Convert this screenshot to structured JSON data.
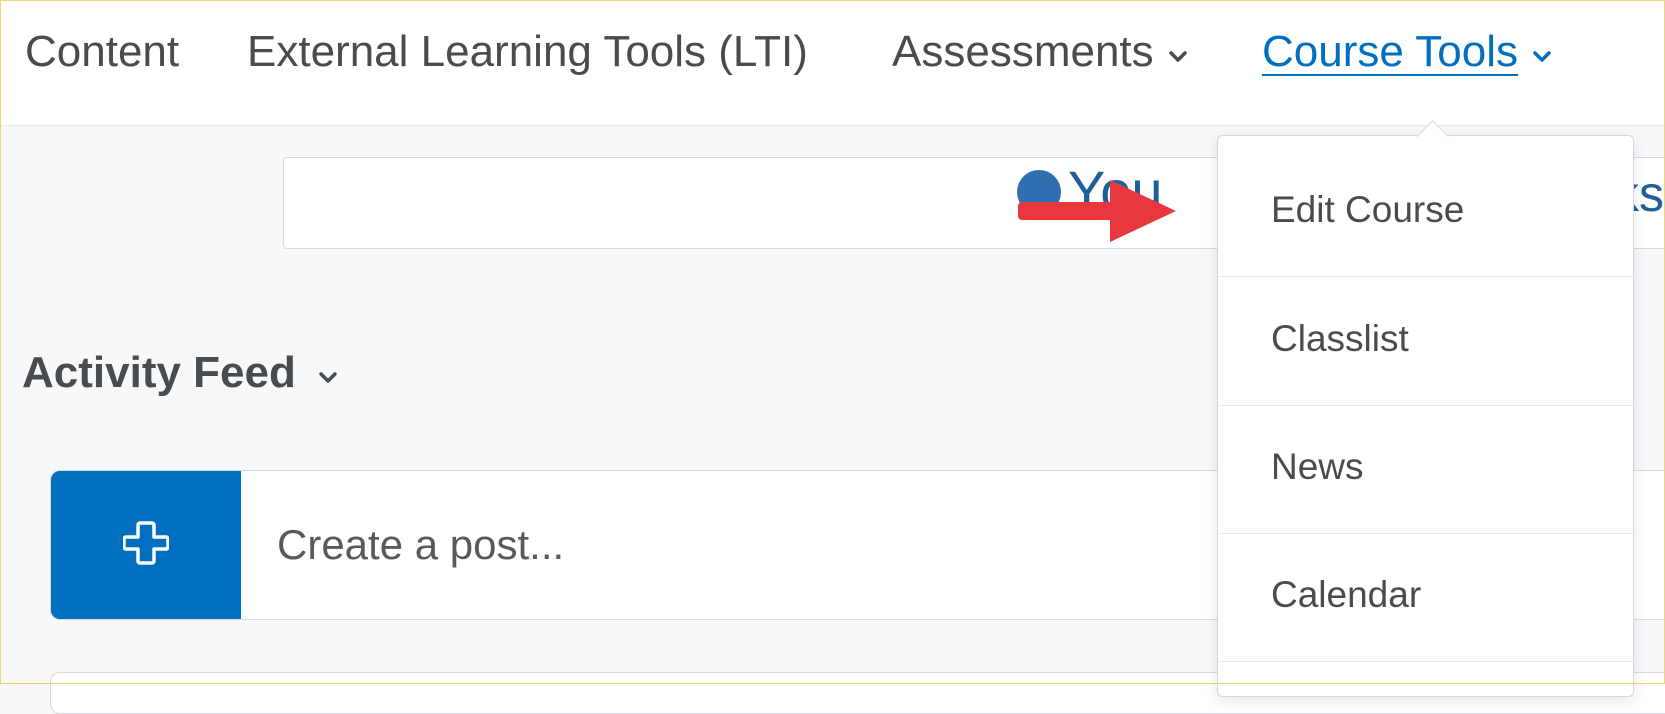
{
  "navbar": {
    "items": [
      {
        "label": "Content",
        "has_chevron": false
      },
      {
        "label": "External Learning Tools (LTI)",
        "has_chevron": false
      },
      {
        "label": "Assessments",
        "has_chevron": true
      },
      {
        "label": "Course Tools",
        "has_chevron": true,
        "active": true
      }
    ]
  },
  "notice": {
    "icon": "check-circle-icon",
    "partial_text": "You",
    "partial_text_right": "ks"
  },
  "activity_feed": {
    "title": "Activity Feed",
    "post_placeholder": "Create a post...",
    "post_button_icon": "plus-icon"
  },
  "course_tools_menu": {
    "items": [
      {
        "label": "Edit Course"
      },
      {
        "label": "Classlist"
      },
      {
        "label": "News"
      },
      {
        "label": "Calendar"
      }
    ]
  },
  "annotation": {
    "icon": "red-arrow-icon",
    "color": "#e8383d"
  },
  "colors": {
    "accent": "#006fbf",
    "text": "#494c4e",
    "link": "#1e5f97",
    "border": "#d3d9e3"
  }
}
